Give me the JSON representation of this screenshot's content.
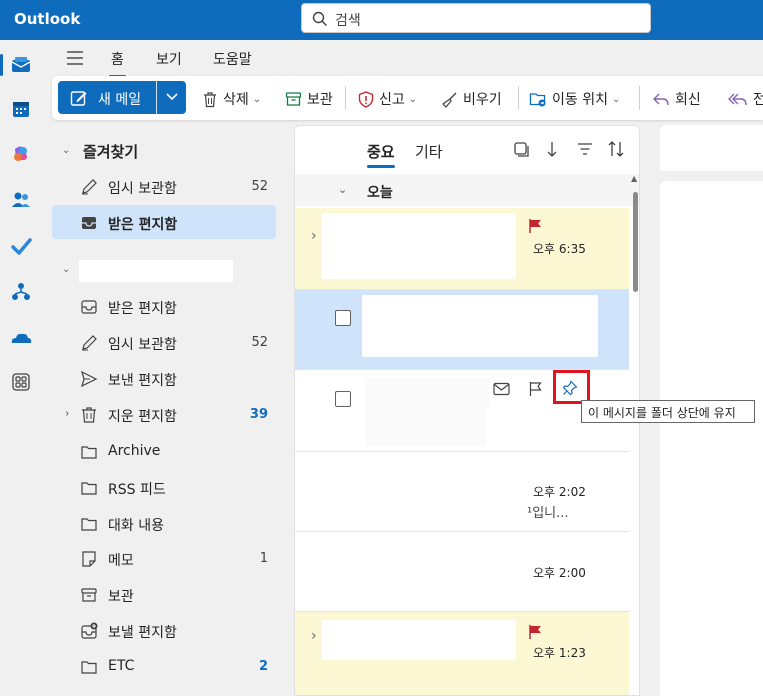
{
  "app": {
    "title": "Outlook"
  },
  "search": {
    "placeholder": "검색"
  },
  "nav_tabs": [
    "홈",
    "보기",
    "도움말"
  ],
  "ribbon": {
    "new_mail": "새 메일",
    "delete": "삭제",
    "archive": "보관",
    "report": "신고",
    "sweep": "비우기",
    "move": "이동 위치",
    "reply": "회신",
    "forward_partial": "전"
  },
  "favorites": {
    "header": "즐겨찾기",
    "items": [
      {
        "label": "임시 보관함",
        "count": "52"
      },
      {
        "label": "받은 편지함",
        "count": ""
      }
    ]
  },
  "account": {
    "folders": [
      {
        "label": "받은 편지함",
        "count": ""
      },
      {
        "label": "임시 보관함",
        "count": "52"
      },
      {
        "label": "보낸 편지함",
        "count": ""
      },
      {
        "label": "지운 편지함",
        "count": "39"
      },
      {
        "label": "Archive",
        "count": ""
      },
      {
        "label": "RSS 피드",
        "count": ""
      },
      {
        "label": "대화 내용",
        "count": ""
      },
      {
        "label": "메모",
        "count": "1"
      },
      {
        "label": "보관",
        "count": ""
      },
      {
        "label": "보낼 편지함",
        "count": ""
      },
      {
        "label": "ETC",
        "count": "2"
      }
    ]
  },
  "message_list": {
    "tabs": [
      "중요",
      "기타"
    ],
    "group_label": "오늘",
    "messages": [
      {
        "time": "오후 6:35",
        "flagged": true,
        "unread": true
      },
      {
        "time": "",
        "flagged": false,
        "selected": true
      },
      {
        "time": "",
        "flagged": false,
        "hover": true
      },
      {
        "time": "오후 2:02",
        "preview": "¹입니..."
      },
      {
        "time": "오후 2:00"
      },
      {
        "time": "오후 1:23",
        "flagged": true,
        "unread": true
      }
    ]
  },
  "tooltip": {
    "text": "이 메시지를 폴더 상단에 유지"
  },
  "colors": {
    "accent": "#0f6cbd",
    "flag": "#c4262e",
    "highlight": "#e0141e",
    "unread_bg": "#fdf8d4",
    "selected_bg": "#cfe4fa"
  }
}
